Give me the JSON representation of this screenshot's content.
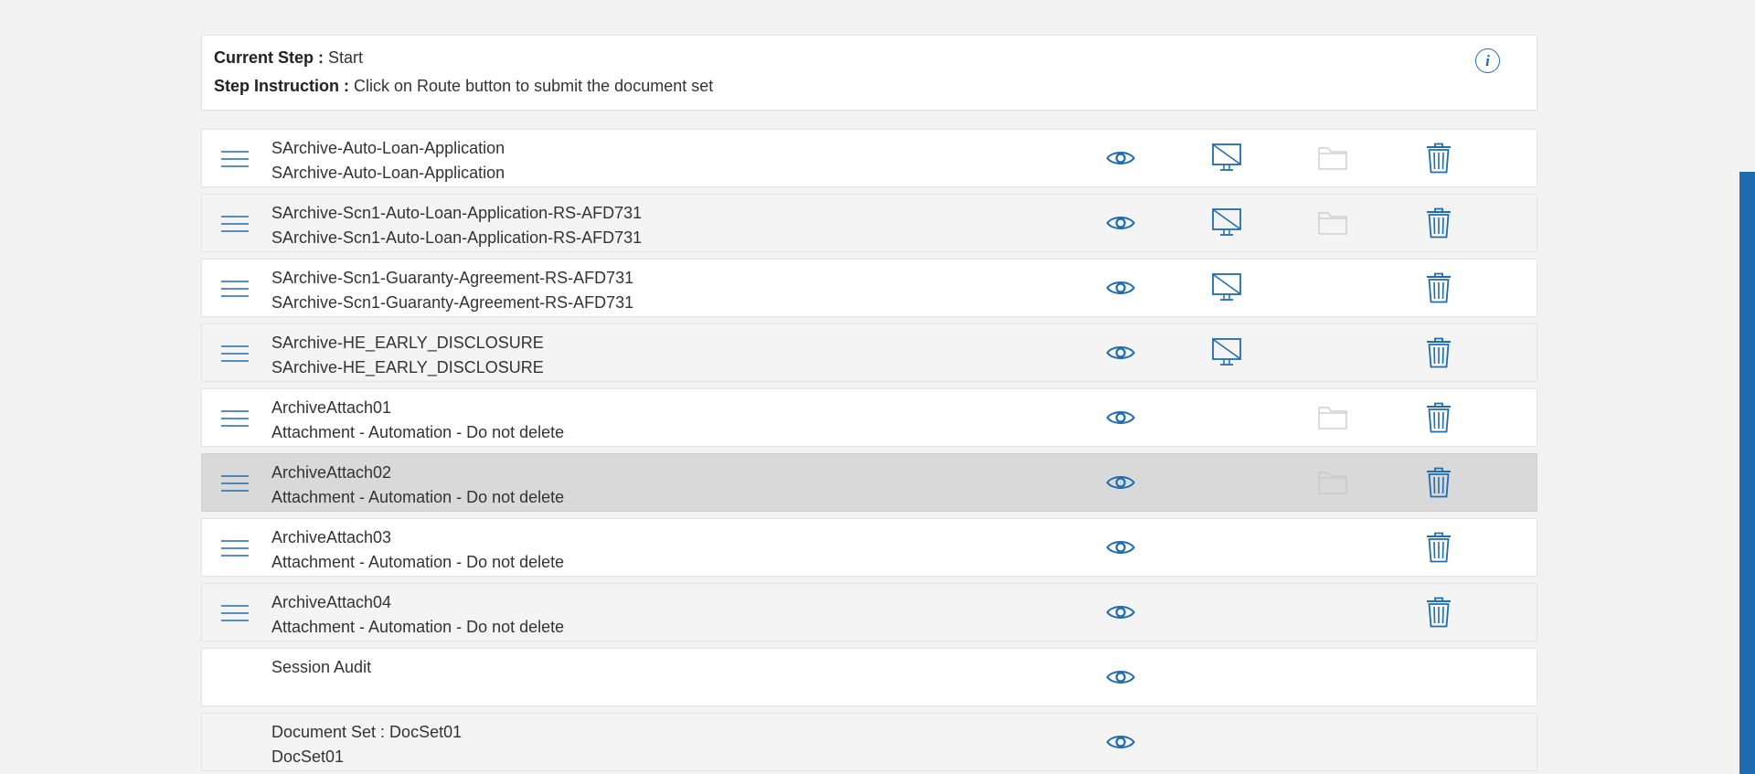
{
  "step_panel": {
    "current_step_label": "Current Step :",
    "current_step_value": "Start",
    "instruction_label": "Step Instruction :",
    "instruction_value": "Click on Route button to submit the document set",
    "info_icon": "info-icon"
  },
  "colors": {
    "accent": "#1f6cb0",
    "disabled_icon": "#c8c8c8",
    "selected_row": "#d9d9d9"
  },
  "documents": [
    {
      "title": "SArchive-Auto-Loan-Application",
      "subtitle": "SArchive-Auto-Loan-Application"
    },
    {
      "title": "SArchive-Scn1-Auto-Loan-Application-RS-AFD731",
      "subtitle": "SArchive-Scn1-Auto-Loan-Application-RS-AFD731"
    },
    {
      "title": "SArchive-Scn1-Guaranty-Agreement-RS-AFD731",
      "subtitle": "SArchive-Scn1-Guaranty-Agreement-RS-AFD731"
    },
    {
      "title": "SArchive-HE_EARLY_DISCLOSURE",
      "subtitle": "SArchive-HE_EARLY_DISCLOSURE"
    },
    {
      "title": "ArchiveAttach01",
      "subtitle": "Attachment - Automation - Do not delete"
    },
    {
      "title": "ArchiveAttach02",
      "subtitle": "Attachment - Automation - Do not delete"
    },
    {
      "title": "ArchiveAttach03",
      "subtitle": "Attachment - Automation - Do not delete"
    },
    {
      "title": "ArchiveAttach04",
      "subtitle": "Attachment - Automation - Do not delete"
    },
    {
      "title": "Session Audit",
      "subtitle": ""
    },
    {
      "title": "Document Set : DocSet01",
      "subtitle": "DocSet01"
    }
  ],
  "icons": {
    "drag": "drag-handle-icon",
    "view": "eye-icon",
    "monitor": "monitor-disabled-icon",
    "folder": "folder-icon",
    "delete": "trash-icon"
  }
}
